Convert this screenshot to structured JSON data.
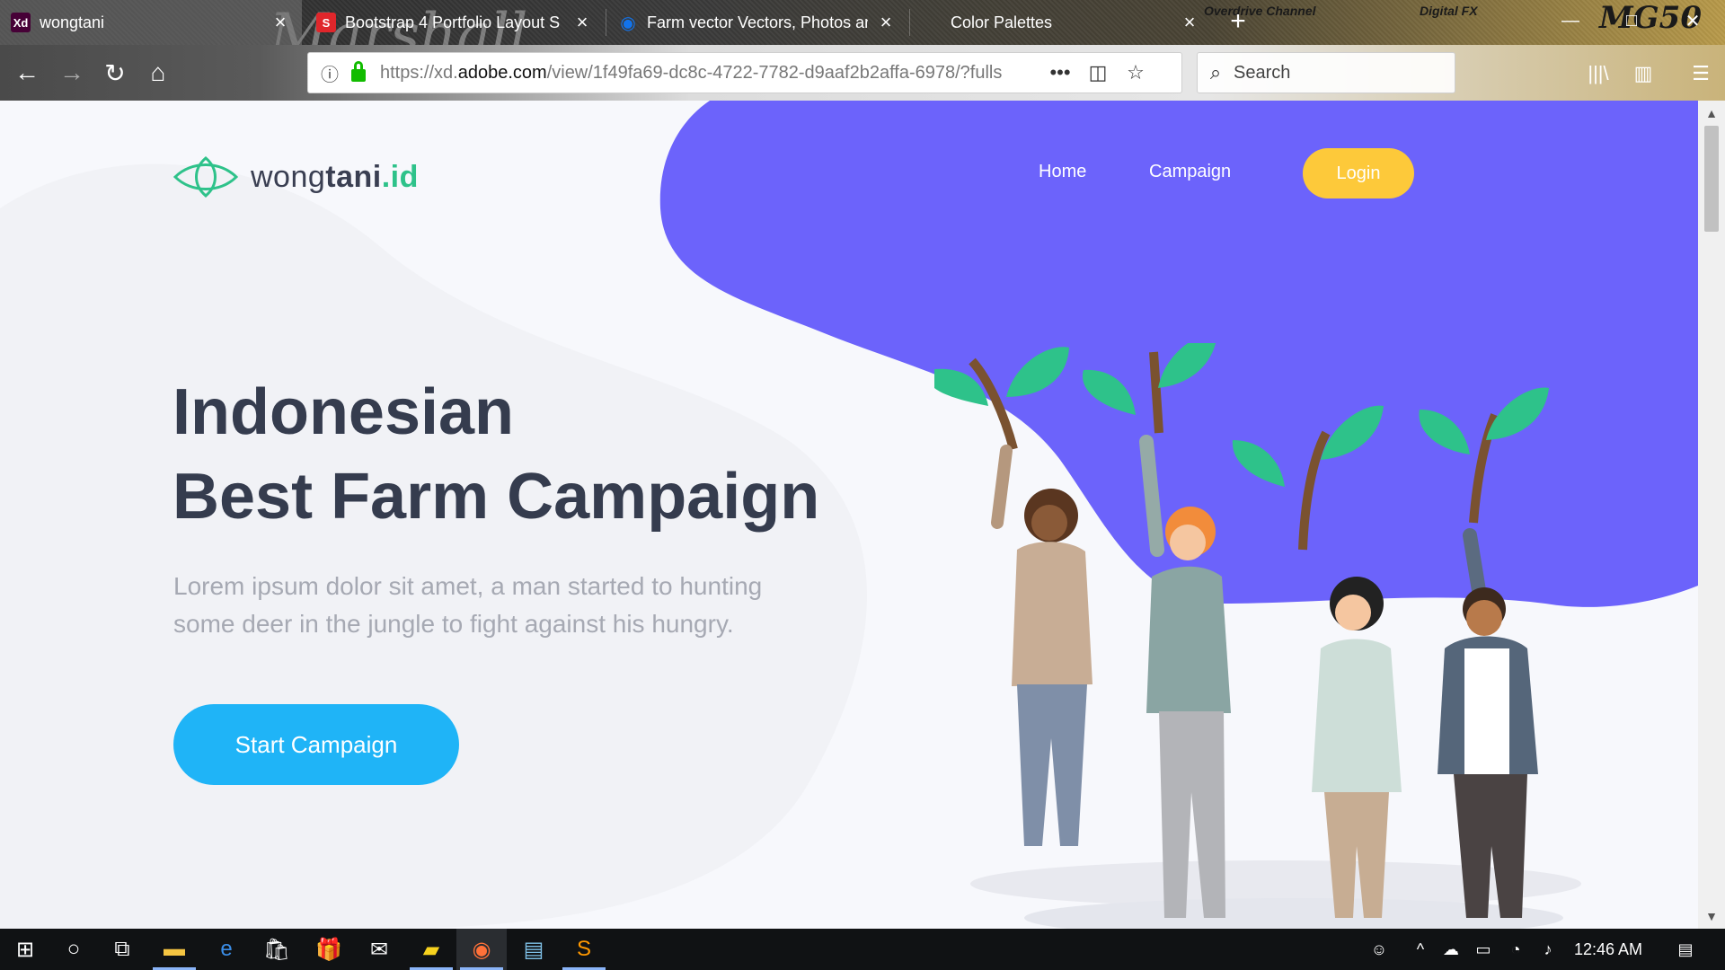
{
  "browser": {
    "tabs": [
      {
        "title": "wongtani",
        "favicon": "adobe-xd-icon",
        "favicon_text": "Xd",
        "favicon_color": "#470137",
        "active": true
      },
      {
        "title": "Bootstrap 4 Portfolio Layout S",
        "favicon": "s-icon",
        "favicon_text": "S",
        "favicon_color": "#e0262b",
        "active": false
      },
      {
        "title": "Farm vector Vectors, Photos an",
        "favicon": "freepik-icon",
        "favicon_text": "◉",
        "favicon_color": "#1273eb",
        "active": false
      },
      {
        "title": "Color Palettes",
        "favicon": "",
        "favicon_text": "",
        "favicon_color": "",
        "active": false
      }
    ],
    "url_prefix": "https://xd.",
    "url_domain": "adobe.com",
    "url_rest": "/view/1f49fa69-dc8c-4722-7782-d9aaf2b2affa-6978/?fulls",
    "search_placeholder": "Search",
    "theme_text": "Marshall",
    "theme_brand": "MG50",
    "theme_channel": "Overdrive Channel",
    "theme_fx": "Digital FX"
  },
  "site": {
    "logo": {
      "part1": "wong",
      "part2": "tani",
      "part3": ".id"
    },
    "nav": {
      "home": "Home",
      "campaign": "Campaign",
      "login": "Login"
    },
    "hero": {
      "title_line1": "Indonesian",
      "title_line2": "Best Farm Campaign",
      "description": "Lorem ipsum dolor sit amet, a man started to hunting some deer in the jungle to fight against his hungry.",
      "cta": "Start Campaign"
    },
    "colors": {
      "blob": "#6c63fb",
      "accent_green": "#2ec28a",
      "login_yellow": "#fdc93a",
      "cta_blue": "#1fb4f7",
      "title": "#353c4e"
    }
  },
  "taskbar": {
    "time": "12:46 AM",
    "apps": [
      "start-icon",
      "cortana-icon",
      "task-view-icon",
      "file-explorer-icon",
      "edge-icon",
      "store-icon",
      "gift-icon",
      "mail-icon",
      "sticky-notes-icon",
      "firefox-icon",
      "notepad-icon",
      "sublime-icon"
    ]
  }
}
